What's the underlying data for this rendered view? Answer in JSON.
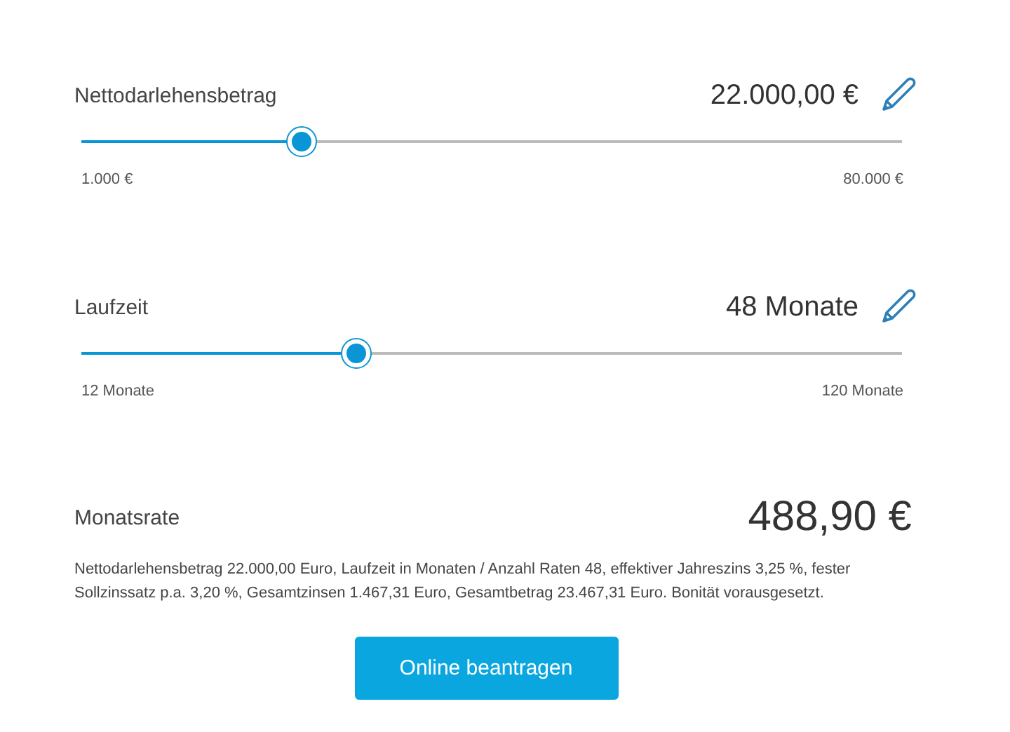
{
  "sliders": [
    {
      "label": "Nettodarlehensbetrag",
      "value": "22.000,00 €",
      "level": 0.27,
      "min": "1.000 €",
      "max": "80.000 €"
    },
    {
      "label": "Laufzeit",
      "value": "48 Monate",
      "level": 0.337,
      "min": "12 Monate",
      "max": "120 Monate"
    }
  ],
  "rate": {
    "label": "Monatsrate",
    "value": "488,90 €"
  },
  "disclaimer": "Nettodarlehensbetrag 22.000,00 Euro, Laufzeit in Monaten / Anzahl Raten 48, effektiver Jahreszins 3,25 %, fester Sollzinssatz p.a. 3,20 %, Gesamtzinsen 1.467,31 Euro, Gesamtbetrag 23.467,31 Euro. Bonität vorausgesetzt.",
  "button": "Online beantragen"
}
